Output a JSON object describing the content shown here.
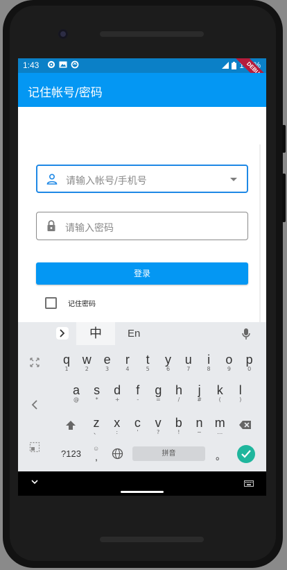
{
  "status_bar": {
    "time": "1:43",
    "battery": "100%",
    "debug_banner": "DEBUG",
    "icons": [
      "settings-icon",
      "image-icon",
      "data-saver-icon",
      "signal-icon",
      "battery-icon"
    ]
  },
  "app_bar": {
    "title": "记住帐号/密码"
  },
  "form": {
    "account_placeholder": "请输入帐号/手机号",
    "password_placeholder": "请输入密码",
    "login_label": "登录",
    "remember_label": "记住密码",
    "remember_checked": false
  },
  "keyboard": {
    "tab_chinese": "中",
    "tab_english": "En",
    "rows": [
      [
        {
          "k": "q",
          "s": "1"
        },
        {
          "k": "w",
          "s": "2"
        },
        {
          "k": "e",
          "s": "3"
        },
        {
          "k": "r",
          "s": "4"
        },
        {
          "k": "t",
          "s": "5"
        },
        {
          "k": "y",
          "s": "6"
        },
        {
          "k": "u",
          "s": "7"
        },
        {
          "k": "i",
          "s": "8"
        },
        {
          "k": "o",
          "s": "9"
        },
        {
          "k": "p",
          "s": "0"
        }
      ],
      [
        {
          "k": "a",
          "s": "@"
        },
        {
          "k": "s",
          "s": "*"
        },
        {
          "k": "d",
          "s": "+"
        },
        {
          "k": "f",
          "s": "-"
        },
        {
          "k": "g",
          "s": "="
        },
        {
          "k": "h",
          "s": "/"
        },
        {
          "k": "j",
          "s": "#"
        },
        {
          "k": "k",
          "s": "("
        },
        {
          "k": "l",
          "s": ")"
        }
      ],
      [
        {
          "k": "z",
          "s": "、"
        },
        {
          "k": "x",
          "s": ":"
        },
        {
          "k": "c",
          "s": "'"
        },
        {
          "k": "v",
          "s": "?"
        },
        {
          "k": "b",
          "s": "!"
        },
        {
          "k": "n",
          "s": "~"
        },
        {
          "k": "m",
          "s": "…"
        }
      ]
    ],
    "symbols_label": "?123",
    "comma_label": ",",
    "space_label": "拼音",
    "period_label": "。",
    "accent_color": "#1fb69d"
  },
  "colors": {
    "primary": "#0497f3",
    "status_bar": "#0b80c7",
    "focus_border": "#1e88e5"
  }
}
